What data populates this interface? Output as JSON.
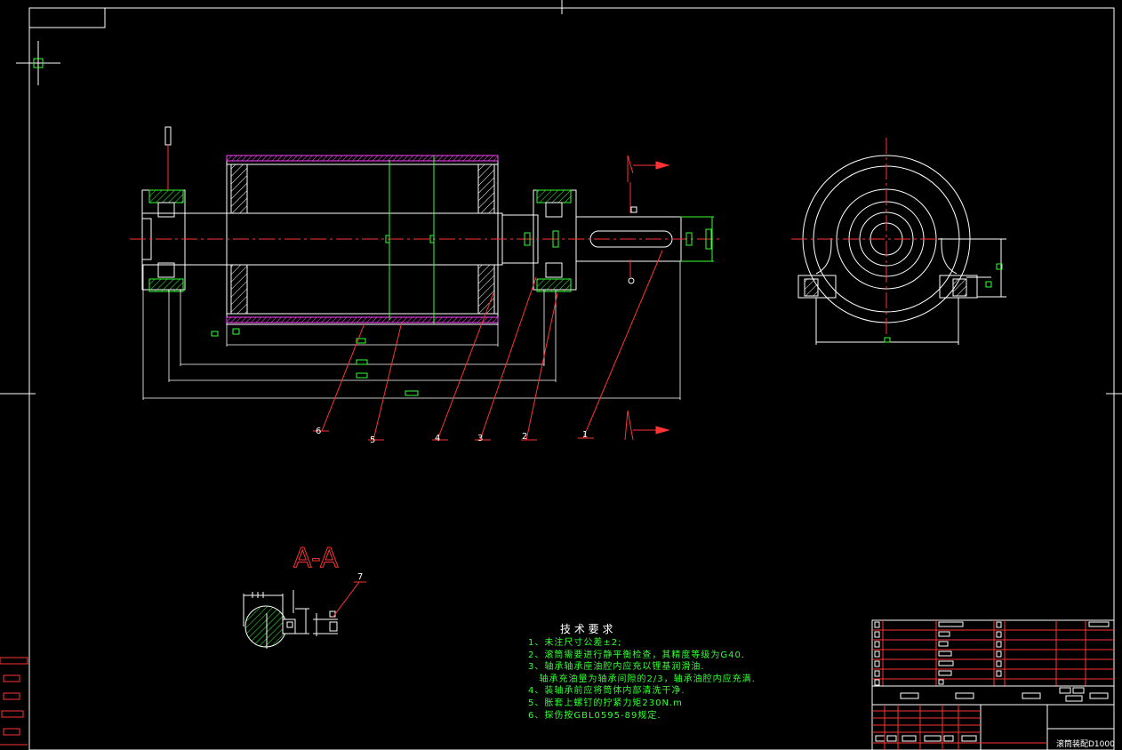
{
  "section_view": {
    "label": "A-A",
    "section_mark": "A"
  },
  "callouts": [
    "1",
    "2",
    "3",
    "4",
    "5",
    "6",
    "7"
  ],
  "tech_requirements": {
    "title": "技 术 要 求",
    "lines": [
      "1、未注尺寸公差±2;",
      "2、滚筒需要进行静平衡检查，其精度等级为G40.",
      "3、轴承轴承座油腔内应充以锂基润滑油.",
      "   轴承充油量为轴承间隙的2/3，轴承油腔内应充满.",
      "4、装轴承前应将筒体内部清洗干净.",
      "5、胀套上螺钉的拧紧力矩230N.m",
      "6、探伤按GBL0595-89规定."
    ]
  },
  "title_block": {
    "drawing_name": "滚筒装配D1000"
  },
  "colors": {
    "background": "#000000",
    "outline": "#ffffff",
    "dimension": "#33ff33",
    "centerline": "#ff3333",
    "hatch": "#ff44ff",
    "section": "#ff3333"
  }
}
